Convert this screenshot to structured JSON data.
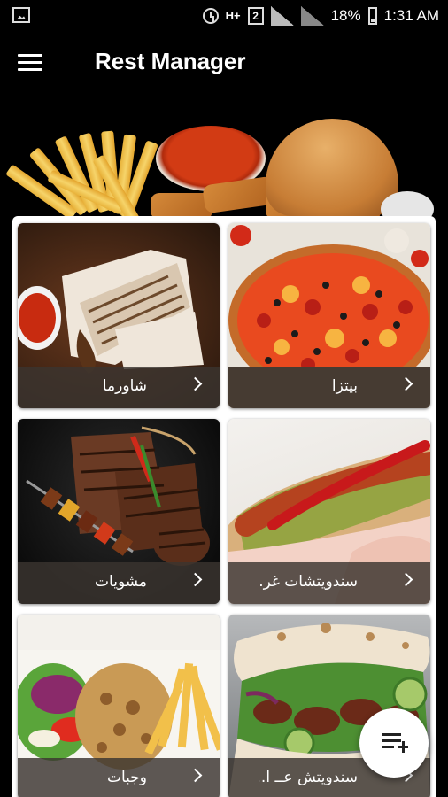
{
  "status_bar": {
    "network_type": "H+",
    "sim_slot": "2",
    "battery": "18%",
    "time": "1:31 AM",
    "icons": [
      "gallery-icon",
      "alarm-icon",
      "signal-icon",
      "battery-icon"
    ]
  },
  "app_bar": {
    "title": "Rest Manager",
    "menu_icon": "menu-icon"
  },
  "categories": [
    {
      "label": "شاورما",
      "icon": "chevron-right-icon"
    },
    {
      "label": "بيتزا",
      "icon": "chevron-right-icon"
    },
    {
      "label": "مشويات",
      "icon": "chevron-right-icon"
    },
    {
      "label": "سندويتشات غر..",
      "icon": "chevron-right-icon"
    },
    {
      "label": "وجبات",
      "icon": "chevron-right-icon"
    },
    {
      "label": "سندويتش عــ ا..",
      "icon": "chevron-right-icon"
    }
  ],
  "fab": {
    "icon": "playlist-add-icon"
  }
}
